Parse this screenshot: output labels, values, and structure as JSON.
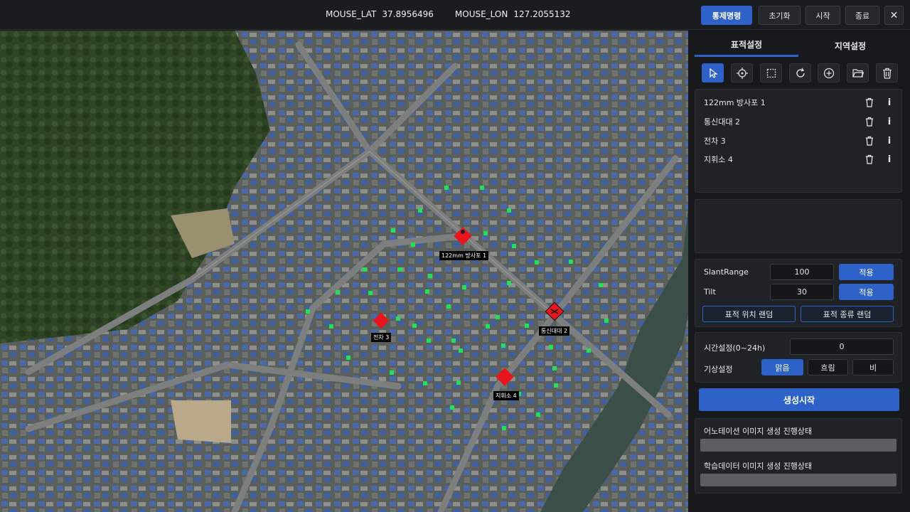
{
  "header": {
    "mouse_lat_label": "MOUSE_LAT",
    "mouse_lat_value": "37.8956496",
    "mouse_lon_label": "MOUSE_LON",
    "mouse_lon_value": "127.2055132",
    "buttons": {
      "control": "통제명령",
      "reset": "초기화",
      "start": "시작",
      "exit": "종료",
      "close": "✕"
    }
  },
  "tabs": [
    "표적설정",
    "지역설정"
  ],
  "toolbar": {
    "icons": [
      "cursor-icon",
      "crosshair-icon",
      "select-rect-icon",
      "refresh-icon",
      "add-icon",
      "folder-open-icon",
      "trash-icon"
    ]
  },
  "targets": [
    {
      "name": "122mm 방사포 1"
    },
    {
      "name": "통신대대 2"
    },
    {
      "name": "전차 3"
    },
    {
      "name": "지휘소 4"
    }
  ],
  "map_markers": [
    {
      "label": "122mm 방사포 1"
    },
    {
      "label": "전차 3"
    },
    {
      "label": "통신대대 2"
    },
    {
      "label": "지휘소 4"
    }
  ],
  "camera": {
    "slant_label": "SlantRange",
    "slant_value": "100",
    "tilt_label": "Tilt",
    "tilt_value": "30",
    "apply_label": "적용",
    "random_pos": "표적 위치 랜덤",
    "random_type": "표적 종류 랜덤"
  },
  "environment": {
    "time_label": "시간설정(0~24h)",
    "time_value": "0",
    "weather_label": "기상설정",
    "weather_options": [
      "맑음",
      "흐림",
      "비"
    ],
    "weather_selected": "맑음"
  },
  "generate_label": "생성시작",
  "progress": {
    "annotation_label": "어노테이션 이미지 생성 진행상태",
    "annotation_progress": 0,
    "training_label": "학습데이터 이미지 생성 진행상태",
    "training_progress": 0
  },
  "colors": {
    "accent": "#2e62c9",
    "marker": "#e8141e",
    "grid_point": "#22e05a"
  }
}
